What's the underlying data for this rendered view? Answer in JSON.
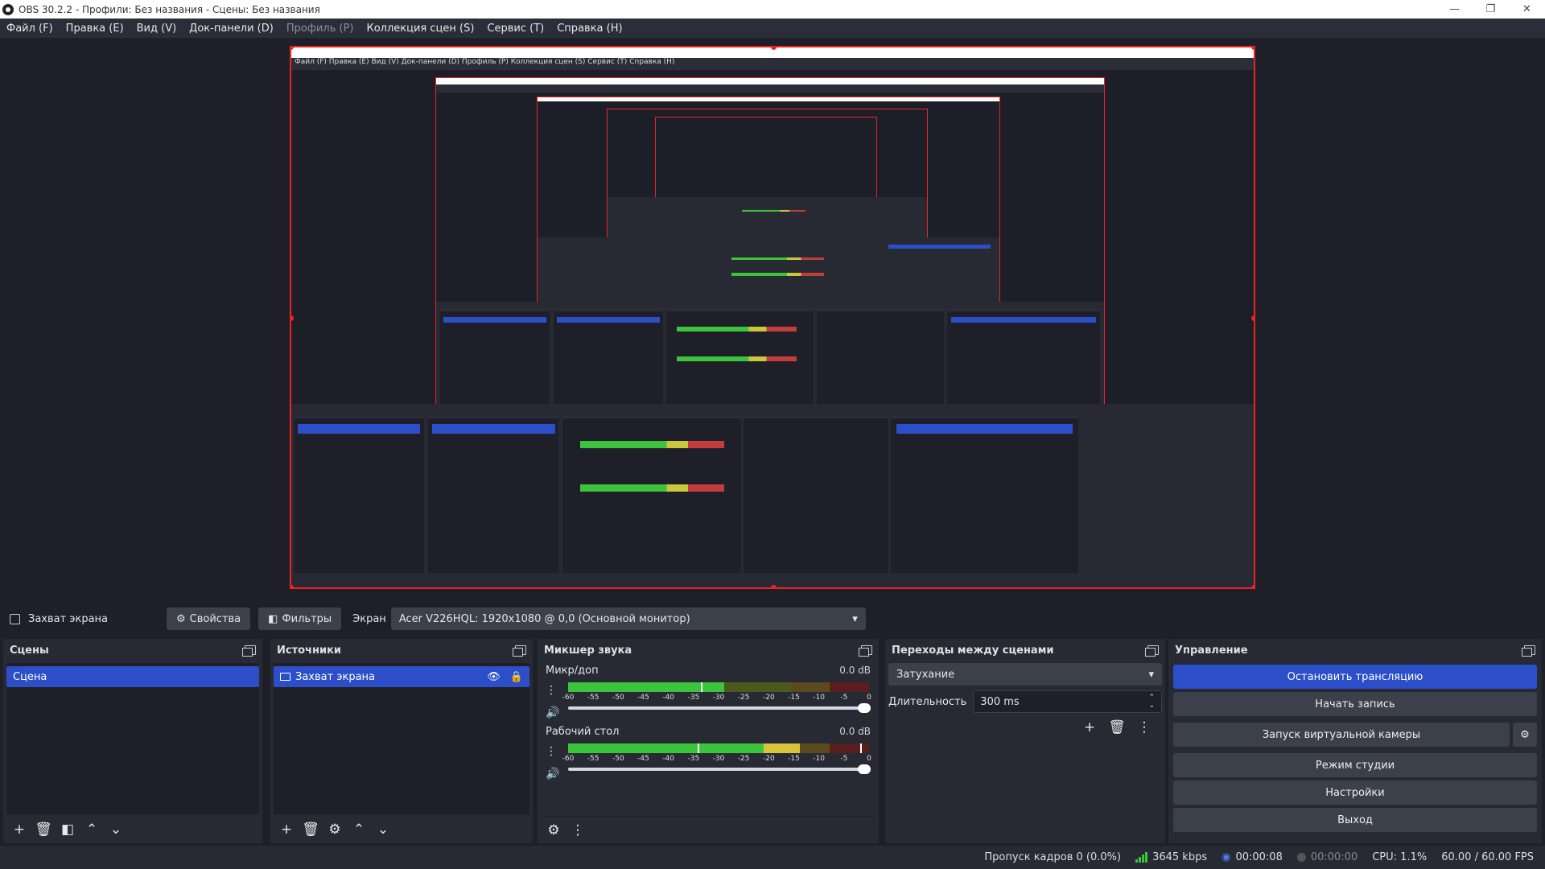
{
  "window": {
    "title": "OBS 30.2.2 - Профили: Без названия - Сцены: Без названия",
    "minimize": "—",
    "restore": "❐",
    "close": "✕"
  },
  "menu": [
    {
      "label": "Файл (F)",
      "disabled": false
    },
    {
      "label": "Правка (E)",
      "disabled": false
    },
    {
      "label": "Вид (V)",
      "disabled": false
    },
    {
      "label": "Док-панели (D)",
      "disabled": false
    },
    {
      "label": "Профиль (P)",
      "disabled": true
    },
    {
      "label": "Коллекция сцен (S)",
      "disabled": false
    },
    {
      "label": "Сервис (T)",
      "disabled": false
    },
    {
      "label": "Справка (H)",
      "disabled": false
    }
  ],
  "sourcebar": {
    "source_name": "Захват экрана",
    "properties_label": "Свойства",
    "filters_label": "Фильтры",
    "display_label": "Экран",
    "display_value": "Acer V226HQL: 1920x1080 @ 0,0 (Основной монитор)"
  },
  "scenes": {
    "title": "Сцены",
    "items": [
      "Сцена"
    ]
  },
  "sources": {
    "title": "Источники",
    "items": [
      "Захват экрана"
    ]
  },
  "mixer": {
    "title": "Микшер звука",
    "ticks": [
      "-60",
      "-55",
      "-50",
      "-45",
      "-40",
      "-35",
      "-30",
      "-25",
      "-20",
      "-15",
      "-10",
      "-5",
      "0"
    ],
    "channels": [
      {
        "name": "Микр/доп",
        "db": "0.0 dB"
      },
      {
        "name": "Рабочий стол",
        "db": "0.0 dB"
      }
    ]
  },
  "transitions": {
    "title": "Переходы между сценами",
    "selected": "Затухание",
    "duration_label": "Длительность",
    "duration_value": "300 ms"
  },
  "controls": {
    "title": "Управление",
    "stop_stream": "Остановить трансляцию",
    "start_record": "Начать запись",
    "virtual_cam": "Запуск виртуальной камеры",
    "studio_mode": "Режим студии",
    "settings": "Настройки",
    "exit": "Выход"
  },
  "status": {
    "dropped": "Пропуск кадров 0 (0.0%)",
    "bitrate": "3645 kbps",
    "stream_time": "00:00:08",
    "record_time": "00:00:00",
    "cpu": "CPU: 1.1%",
    "fps": "60.00 / 60.00 FPS"
  },
  "nested_menu": "Файл (F)   Правка (E)   Вид (V)   Док-панели (D)   Профиль (P)   Коллекция сцен (S)   Сервис (T)   Справка (H)",
  "colors": {
    "accent": "#2c4fc9",
    "selection_border": "#e22222",
    "bg": "#1e1f29",
    "panel": "#272a33"
  }
}
